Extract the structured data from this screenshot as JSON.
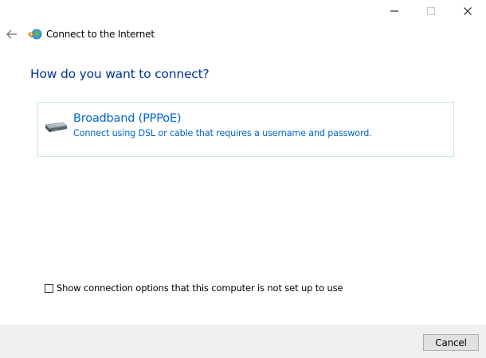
{
  "window": {
    "title": "Connect to the Internet"
  },
  "caption_buttons": {
    "minimize_icon": "minimize-icon",
    "maximize_icon": "maximize-icon",
    "close_icon": "close-icon"
  },
  "main": {
    "heading": "How do you want to connect?",
    "options": [
      {
        "title": "Broadband (PPPoE)",
        "description": "Connect using DSL or cable that requires a username and password.",
        "icon": "broadband-modem-icon"
      }
    ]
  },
  "show_options_checkbox": {
    "label": "Show connection options that this computer is not set up to use",
    "checked": false
  },
  "footer": {
    "cancel_label": "Cancel"
  },
  "colors": {
    "heading": "#003399",
    "link": "#0066cc",
    "option_border": "#bfe6ec",
    "footer_bg": "#f0f0f0"
  }
}
